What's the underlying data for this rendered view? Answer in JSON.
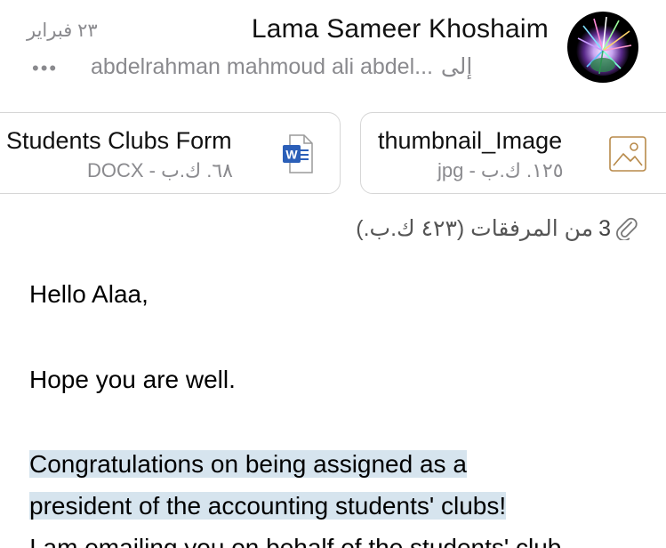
{
  "header": {
    "sender_name": "Lama Sameer Khoshaim",
    "date": "٢٣ فبراير",
    "to_label": "إلى",
    "recipients": "abdelrahman mahmoud ali abdel...",
    "more": "•••"
  },
  "attachments": {
    "summary_count": "3",
    "summary_text": "من المرفقات (٤٢٣ ك.ب.)",
    "items": [
      {
        "name": "Students Clubs Form",
        "meta": "DOCX - ٦٨. ك.ب",
        "icon": "word-doc-icon",
        "icon_letter": "W"
      },
      {
        "name": "thumbnail_Image",
        "meta": "jpg - ١٢٥. ك.ب",
        "icon": "image-file-icon"
      }
    ]
  },
  "body": {
    "greeting": "Hello Alaa,",
    "wish": "Hope you are well.",
    "congrats_line1": "Congratulations on being assigned as a",
    "congrats_line2": "president of the accounting students' clubs!",
    "next_line": "I am emailing you on behalf of the students' club"
  },
  "colors": {
    "secondary_text": "#8a8a8e",
    "highlight": "#d6e4ee",
    "word_blue": "#2b5fb8",
    "card_border": "#d6d6d6"
  }
}
